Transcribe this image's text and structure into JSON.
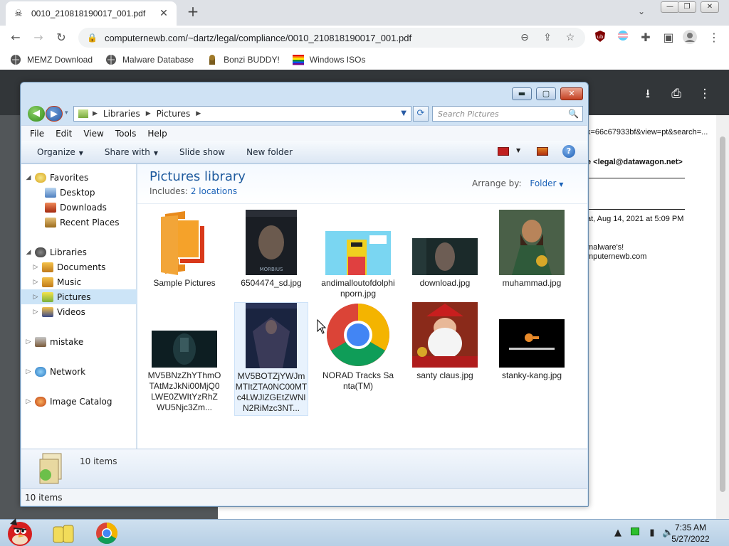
{
  "browser": {
    "tab_title": "0010_210818190017_001.pdf",
    "tab_close": "✕",
    "new_tab": "+",
    "tab_search": "⌄",
    "url": "computernewb.com/~dartz/legal/compliance/0010_210818190017_001.pdf",
    "bookmarks": [
      {
        "label": "MEMZ Download"
      },
      {
        "label": "Malware Database"
      },
      {
        "label": "Bonzi BUDDY!"
      },
      {
        "label": "Windows ISOs"
      }
    ]
  },
  "pdf": {
    "lines": [
      "k=66c67933bf&view=pt&search=...",
      "e <legal@datawagon.net>",
      "at, Aug 14, 2021 at 5:09 PM",
      "malware's!",
      "mputernewb.com"
    ]
  },
  "explorer": {
    "address": {
      "crumb1": "Libraries",
      "crumb2": "Pictures",
      "search_placeholder": "Search Pictures"
    },
    "menu": [
      "File",
      "Edit",
      "View",
      "Tools",
      "Help"
    ],
    "commands": {
      "organize": "Organize",
      "share": "Share with",
      "slideshow": "Slide show",
      "new_folder": "New folder"
    },
    "nav": [
      {
        "label": "Favorites"
      },
      {
        "label": "Desktop"
      },
      {
        "label": "Downloads"
      },
      {
        "label": "Recent Places"
      },
      {
        "label": "Libraries"
      },
      {
        "label": "Documents"
      },
      {
        "label": "Music"
      },
      {
        "label": "Pictures"
      },
      {
        "label": "Videos"
      },
      {
        "label": "mistake"
      },
      {
        "label": "Network"
      },
      {
        "label": "Image Catalog"
      }
    ],
    "library": {
      "title": "Pictures library",
      "includes_label": "Includes:",
      "includes_link": "2 locations",
      "arrange_label": "Arrange by:",
      "arrange_value": "Folder"
    },
    "files": [
      {
        "name": "Sample Pictures"
      },
      {
        "name": "6504474_sd.jpg"
      },
      {
        "name": "andimalloutofdolphinporn.jpg"
      },
      {
        "name": "download.jpg"
      },
      {
        "name": "muhammad.jpg"
      },
      {
        "name": "MV5BNzZhYThmOTAtMzJkNi00MjQ0LWE0ZWItYzRhZWU5Njc3Zm..."
      },
      {
        "name": "MV5BOTZjYWJmMTItZTA0NC00MTc4LWJlZGEtZWNlN2RiMzc3NT..."
      },
      {
        "name": "NORAD Tracks Santa(TM)"
      },
      {
        "name": "santy claus.jpg"
      },
      {
        "name": "stanky-kang.jpg"
      }
    ],
    "details_count": "10 items",
    "status": "10 items"
  },
  "taskbar": {
    "time": "7:35 AM",
    "date": "5/27/2022"
  }
}
